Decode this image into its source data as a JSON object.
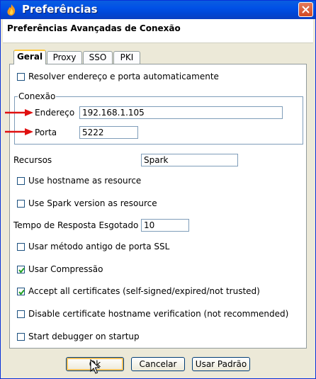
{
  "window": {
    "title": "Preferências",
    "dialog_title": "Preferências Avançadas de Conexão",
    "icons": {
      "app": "spark-flame-icon",
      "close": "close-icon"
    }
  },
  "tabs": [
    {
      "label": "Geral",
      "active": true
    },
    {
      "label": "Proxy",
      "active": false
    },
    {
      "label": "SSO",
      "active": false
    },
    {
      "label": "PKI",
      "active": false
    }
  ],
  "general": {
    "auto_resolve": {
      "label": "Resolver endereço e porta automaticamente",
      "checked": false
    },
    "connection": {
      "legend": "Conexão",
      "address_label": "Endereço",
      "address_value": "192.168.1.105",
      "port_label": "Porta",
      "port_value": "5222"
    },
    "resource": {
      "label": "Recursos",
      "value": "Spark"
    },
    "use_hostname": {
      "label": "Use hostname as resource",
      "checked": false
    },
    "use_spark_version": {
      "label": "Use Spark version as resource",
      "checked": false
    },
    "timeout": {
      "label": "Tempo de Resposta Esgotado",
      "value": "10"
    },
    "old_ssl": {
      "label": "Usar método antigo de porta SSL",
      "checked": false
    },
    "compression": {
      "label": "Usar Compressão",
      "checked": true
    },
    "accept_certs": {
      "label": "Accept all certificates (self-signed/expired/not trusted)",
      "checked": true
    },
    "disable_hostname_verif": {
      "label": "Disable certificate hostname verification (not recommended)",
      "checked": false
    },
    "debugger": {
      "label": "Start debugger on startup",
      "checked": false
    }
  },
  "buttons": {
    "ok": "Ok",
    "cancel": "Cancelar",
    "defaults": "Usar Padrão"
  },
  "annotation_color": "#e01010"
}
